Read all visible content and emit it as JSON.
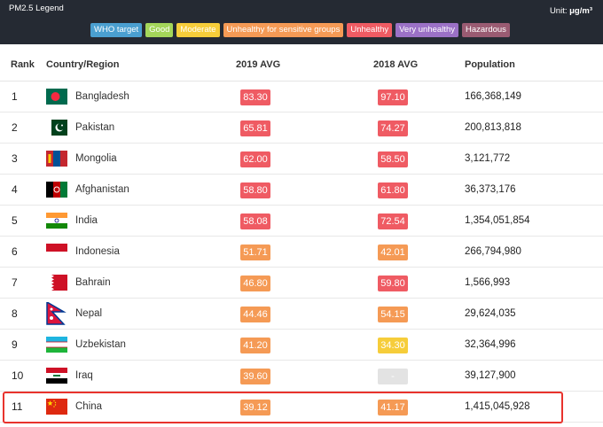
{
  "legend": {
    "title": "PM2.5 Legend",
    "unit_label": "Unit:",
    "unit_value": "μg/m³",
    "items": [
      {
        "label": "WHO target",
        "color": "#4a9fd0"
      },
      {
        "label": "Good",
        "color": "#a4d65a"
      },
      {
        "label": "Moderate",
        "color": "#f6cd3a"
      },
      {
        "label": "Unhealthy for sensitive groups",
        "color": "#f59a55"
      },
      {
        "label": "Unhealthy",
        "color": "#ef5b63"
      },
      {
        "label": "Very unhealthy",
        "color": "#9b71c6"
      },
      {
        "label": "Hazardous",
        "color": "#9a5b72"
      }
    ]
  },
  "table": {
    "headers": {
      "rank": "Rank",
      "country": "Country/Region",
      "avg2019": "2019 AVG",
      "avg2018": "2018 AVG",
      "population": "Population"
    },
    "rows": [
      {
        "rank": "1",
        "country": "Bangladesh",
        "avg2019": "83.30",
        "avg2018": "97.10",
        "population": "166,368,149",
        "flag": "bangladesh-flag-icon",
        "c2019": "#ef5b63",
        "c2018": "#ef5b63"
      },
      {
        "rank": "2",
        "country": "Pakistan",
        "avg2019": "65.81",
        "avg2018": "74.27",
        "population": "200,813,818",
        "flag": "pakistan-flag-icon",
        "c2019": "#ef5b63",
        "c2018": "#ef5b63"
      },
      {
        "rank": "3",
        "country": "Mongolia",
        "avg2019": "62.00",
        "avg2018": "58.50",
        "population": "3,121,772",
        "flag": "mongolia-flag-icon",
        "c2019": "#ef5b63",
        "c2018": "#ef5b63"
      },
      {
        "rank": "4",
        "country": "Afghanistan",
        "avg2019": "58.80",
        "avg2018": "61.80",
        "population": "36,373,176",
        "flag": "afghanistan-flag-icon",
        "c2019": "#ef5b63",
        "c2018": "#ef5b63"
      },
      {
        "rank": "5",
        "country": "India",
        "avg2019": "58.08",
        "avg2018": "72.54",
        "population": "1,354,051,854",
        "flag": "india-flag-icon",
        "c2019": "#ef5b63",
        "c2018": "#ef5b63"
      },
      {
        "rank": "6",
        "country": "Indonesia",
        "avg2019": "51.71",
        "avg2018": "42.01",
        "population": "266,794,980",
        "flag": "indonesia-flag-icon",
        "c2019": "#f59a55",
        "c2018": "#f59a55"
      },
      {
        "rank": "7",
        "country": "Bahrain",
        "avg2019": "46.80",
        "avg2018": "59.80",
        "population": "1,566,993",
        "flag": "bahrain-flag-icon",
        "c2019": "#f59a55",
        "c2018": "#ef5b63"
      },
      {
        "rank": "8",
        "country": "Nepal",
        "avg2019": "44.46",
        "avg2018": "54.15",
        "population": "29,624,035",
        "flag": "nepal-flag-icon",
        "c2019": "#f59a55",
        "c2018": "#f59a55"
      },
      {
        "rank": "9",
        "country": "Uzbekistan",
        "avg2019": "41.20",
        "avg2018": "34.30",
        "population": "32,364,996",
        "flag": "uzbekistan-flag-icon",
        "c2019": "#f59a55",
        "c2018": "#f6cd3a"
      },
      {
        "rank": "10",
        "country": "Iraq",
        "avg2019": "39.60",
        "avg2018": "-",
        "population": "39,127,900",
        "flag": "iraq-flag-icon",
        "c2019": "#f59a55",
        "c2018": "#e3e3e3"
      },
      {
        "rank": "11",
        "country": "China",
        "avg2019": "39.12",
        "avg2018": "41.17",
        "population": "1,415,045,928",
        "flag": "china-flag-icon",
        "c2019": "#f59a55",
        "c2018": "#f59a55"
      }
    ]
  }
}
